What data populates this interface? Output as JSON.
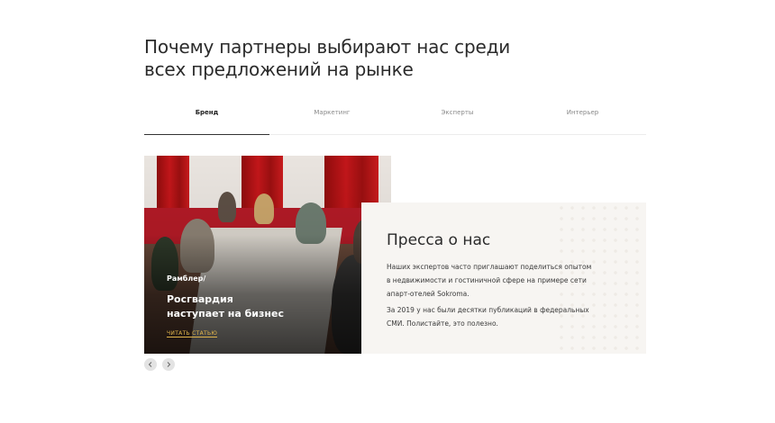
{
  "heading": {
    "line1": "Почему партнеры выбирают нас среди",
    "line2": "всех предложений на рынке"
  },
  "tabs": [
    {
      "label": "Бренд",
      "active": true
    },
    {
      "label": "Маркетинг",
      "active": false
    },
    {
      "label": "Эксперты",
      "active": false
    },
    {
      "label": "Интерьер",
      "active": false
    }
  ],
  "slide": {
    "source": "Рамблер/",
    "title_line1": "Росгвардия",
    "title_line2": "наступает на бизнес",
    "link": "читать статью"
  },
  "press": {
    "title": "Пресса о нас",
    "para1_line1": "Наших экспертов часто приглашают поделиться опытом",
    "para1_line2": "в недвижимости и гостиничной сфере на примере сети",
    "para1_line3": "апарт-отелей Sokroma.",
    "para2_line1": "За 2019 у нас были десятки публикаций в федеральных",
    "para2_line2": "СМИ. Полистайте, это полезно."
  },
  "colors": {
    "accent": "#e0b44b",
    "panel_bg": "#f7f5f2",
    "curtain_red": "#c2161a"
  },
  "icons": {
    "prev": "chevron-left-icon",
    "next": "chevron-right-icon"
  }
}
